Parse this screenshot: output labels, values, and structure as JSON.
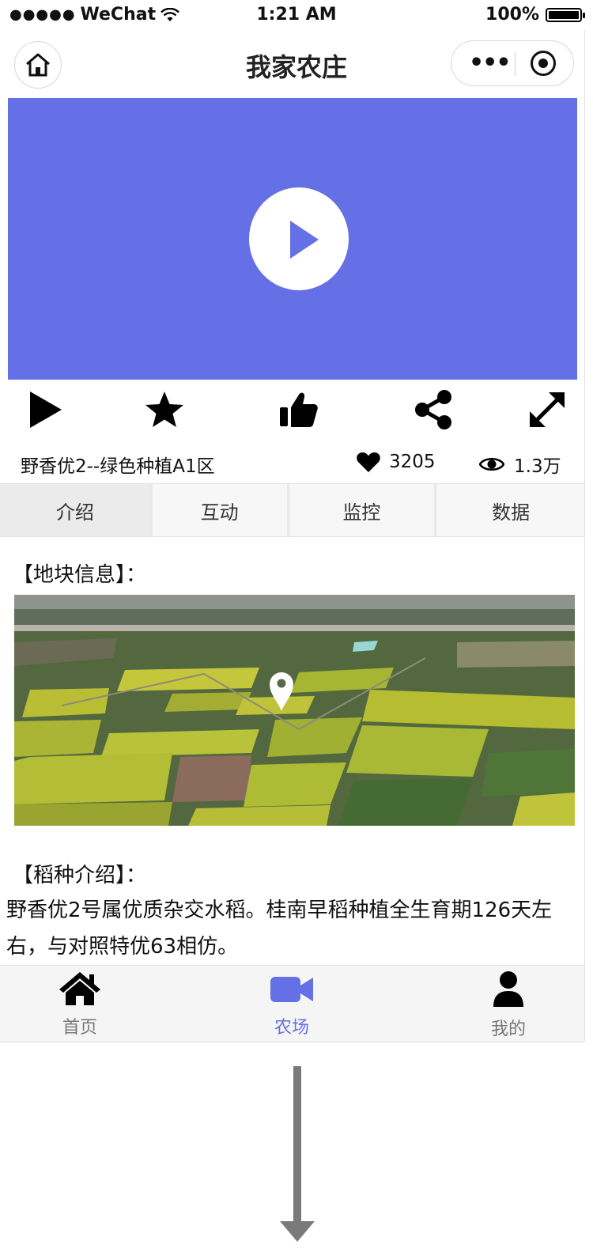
{
  "status_bar": {
    "signal": "●●●●●",
    "carrier": "WeChat",
    "time": "1:21 AM",
    "battery": "100%"
  },
  "nav": {
    "title": "我家农庄",
    "home_icon": "home-icon",
    "more_icon": "more-dots-icon",
    "close_icon": "record-close-icon"
  },
  "video": {
    "play_icon": "play-circle-icon",
    "accent": "#656fe6"
  },
  "actions": [
    "play-icon",
    "star-icon",
    "thumbs-up-icon",
    "share-icon",
    "fullscreen-icon"
  ],
  "info": {
    "title": "野香优2--绿色种植A1区",
    "likes": "3205",
    "views": "1.3万"
  },
  "tabs": [
    {
      "label": "介绍",
      "active": true
    },
    {
      "label": "互动",
      "active": false
    },
    {
      "label": "监控",
      "active": false
    },
    {
      "label": "数据",
      "active": false
    }
  ],
  "content": {
    "plot_heading": "【地块信息】：",
    "map_pin_icon": "location-pin-icon",
    "rice_heading": "【稻种介绍】：",
    "rice_desc": "野香优2号属优质杂交水稻。桂南早稻种植全生育期126天左右，与对照特优63相仿。"
  },
  "tabbar": [
    {
      "label": "首页",
      "icon": "home-icon",
      "active": false
    },
    {
      "label": "农场",
      "icon": "video-camera-icon",
      "active": true
    },
    {
      "label": "我的",
      "icon": "user-icon",
      "active": false
    }
  ]
}
